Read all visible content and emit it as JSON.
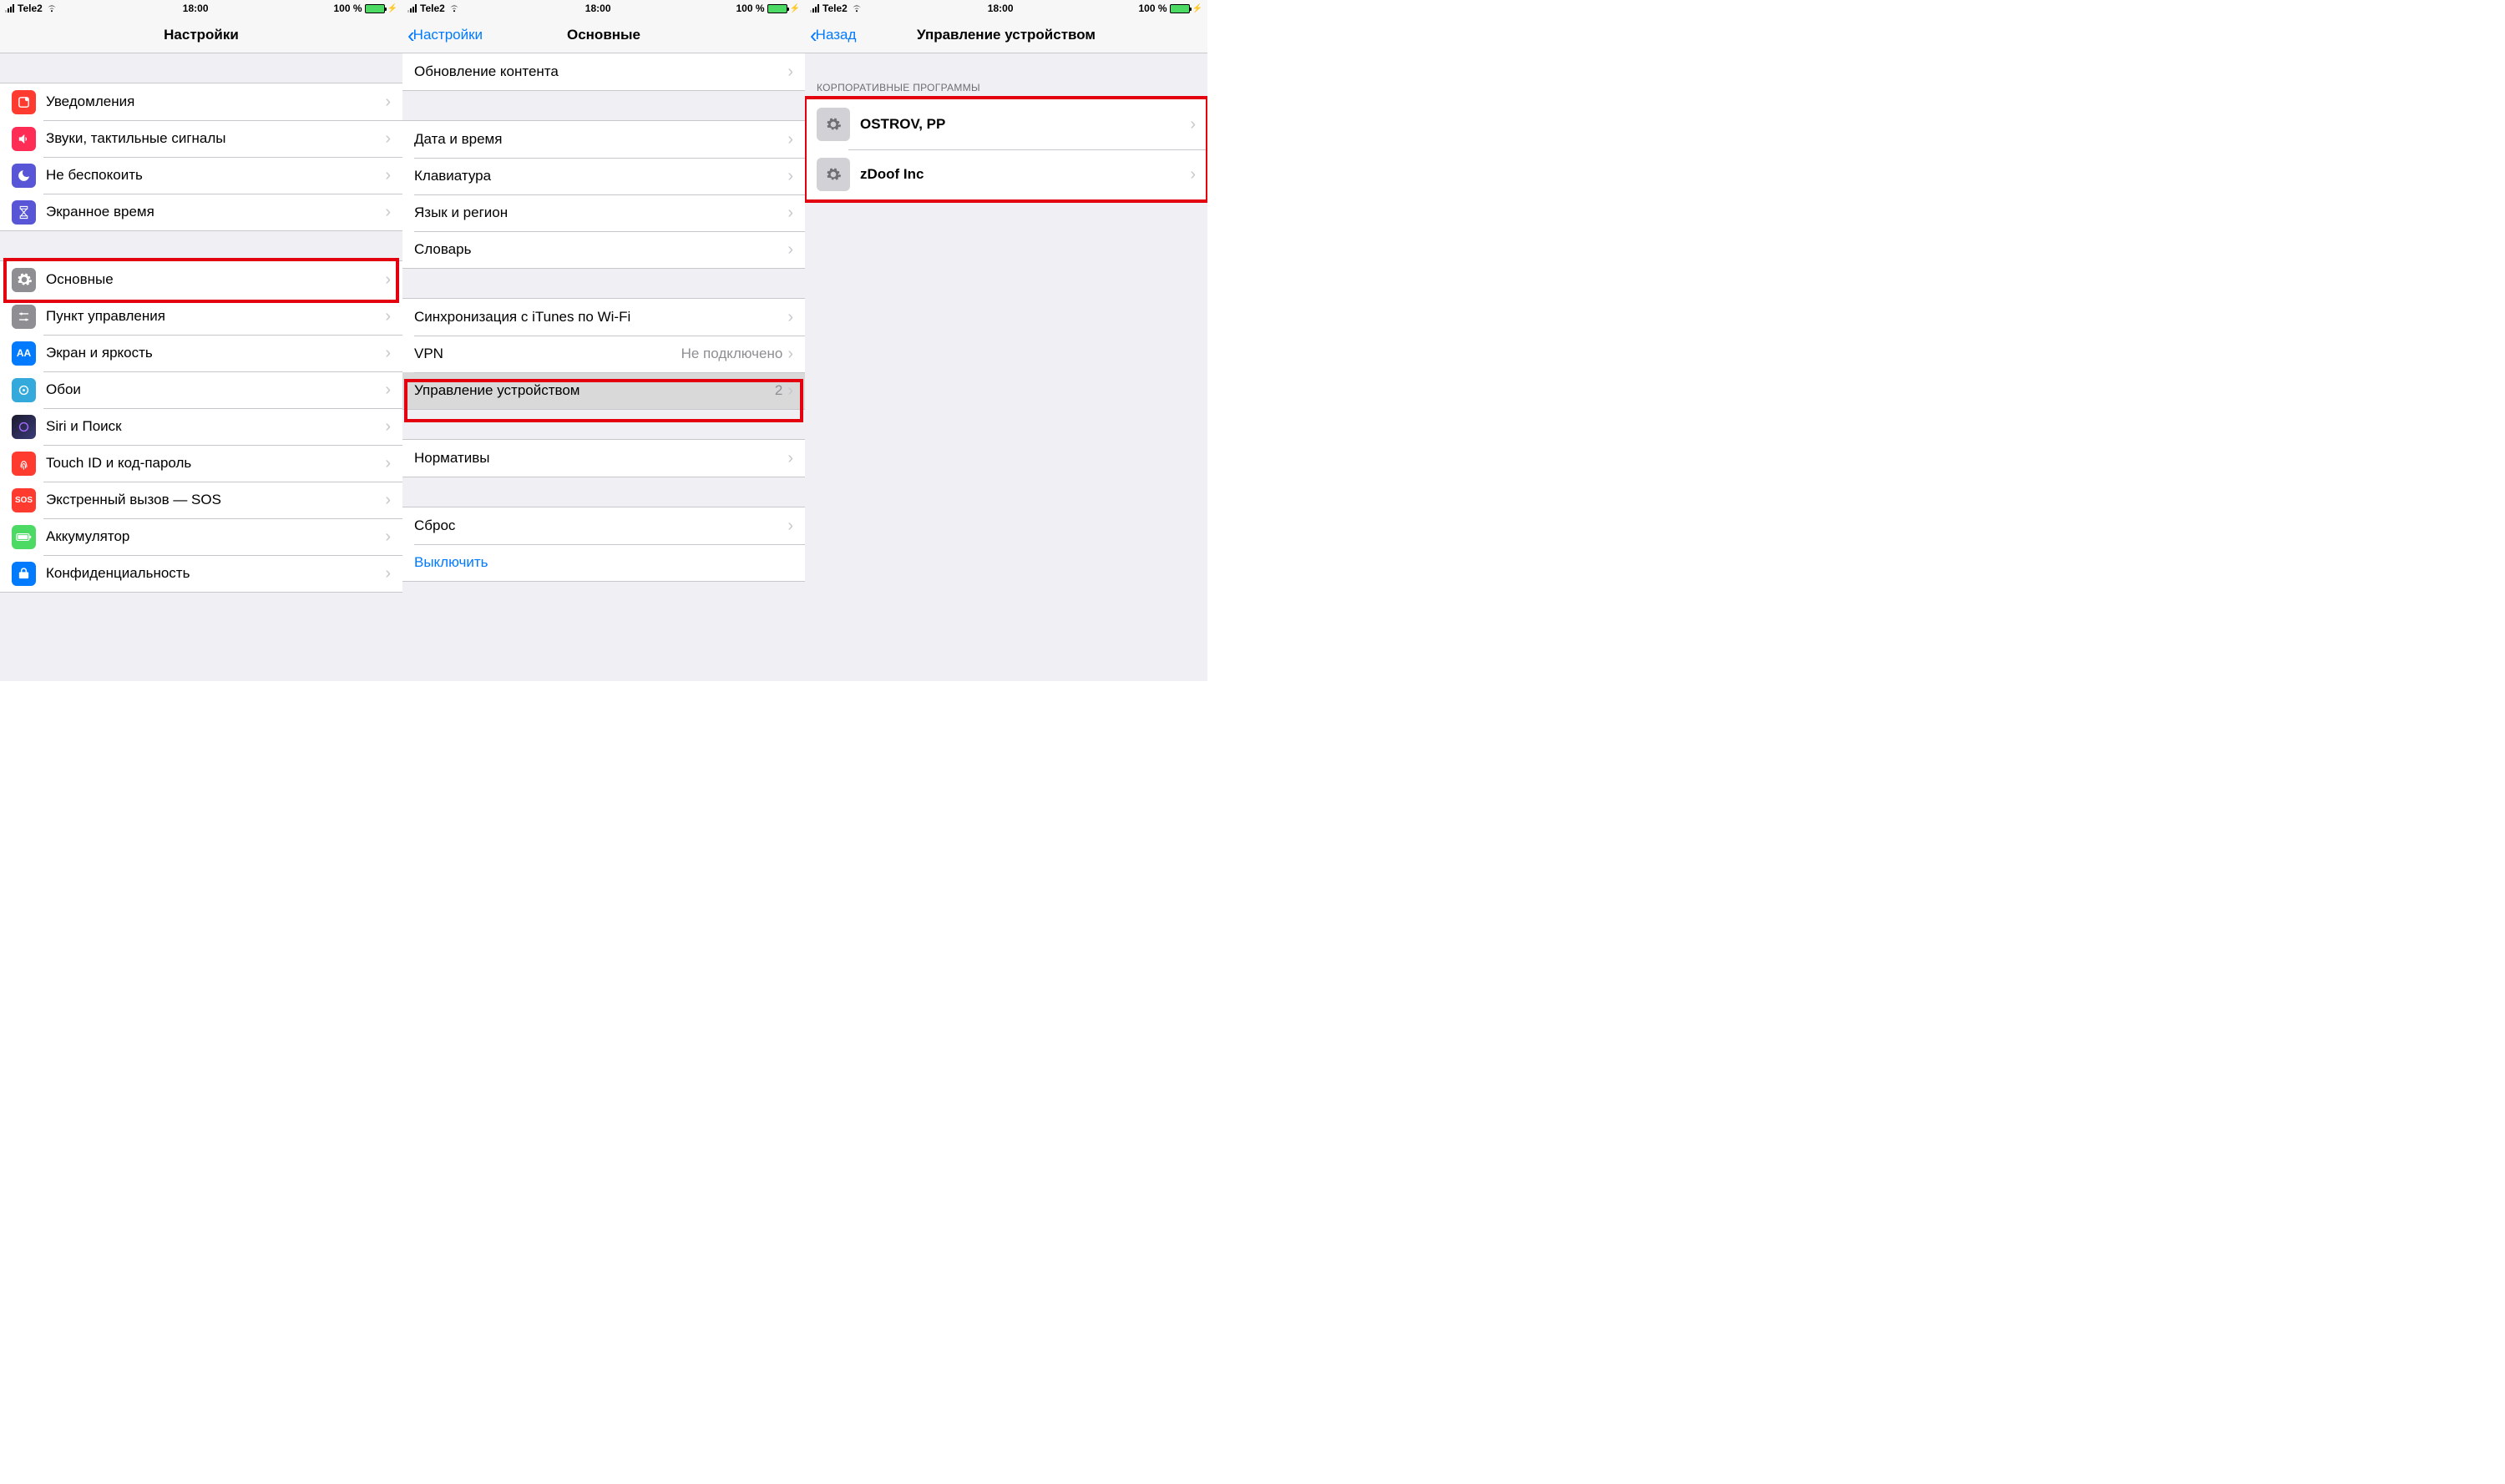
{
  "statusBar": {
    "carrier": "Tele2",
    "time": "18:00",
    "batteryText": "100 %"
  },
  "screen1": {
    "title": "Настройки",
    "group1": [
      {
        "label": "Уведомления"
      },
      {
        "label": "Звуки, тактильные сигналы"
      },
      {
        "label": "Не беспокоить"
      },
      {
        "label": "Экранное время"
      }
    ],
    "group2": [
      {
        "label": "Основные"
      },
      {
        "label": "Пункт управления"
      },
      {
        "label": "Экран и яркость"
      },
      {
        "label": "Обои"
      },
      {
        "label": "Siri и Поиск"
      },
      {
        "label": "Touch ID и код-пароль"
      },
      {
        "label": "Экстренный вызов — SOS"
      },
      {
        "label": "Аккумулятор"
      },
      {
        "label": "Конфиденциальность"
      }
    ]
  },
  "screen2": {
    "back": "Настройки",
    "title": "Основные",
    "rowContentRefresh": "Обновление контента",
    "rowDate": "Дата и время",
    "rowKeyboard": "Клавиатура",
    "rowLang": "Язык и регион",
    "rowDict": "Словарь",
    "rowItunes": "Синхронизация с iTunes по Wi-Fi",
    "rowVpn": "VPN",
    "rowVpnValue": "Не подключено",
    "rowDevMgmt": "Управление устройством",
    "rowDevMgmtCount": "2",
    "rowLegal": "Нормативы",
    "rowReset": "Сброс",
    "rowShutdown": "Выключить"
  },
  "screen3": {
    "back": "Назад",
    "title": "Управление устройством",
    "sectionHeader": "КОРПОРАТИВНЫЕ ПРОГРАММЫ",
    "profiles": [
      {
        "name": "OSTROV, PP"
      },
      {
        "name": "zDoof Inc"
      }
    ]
  }
}
